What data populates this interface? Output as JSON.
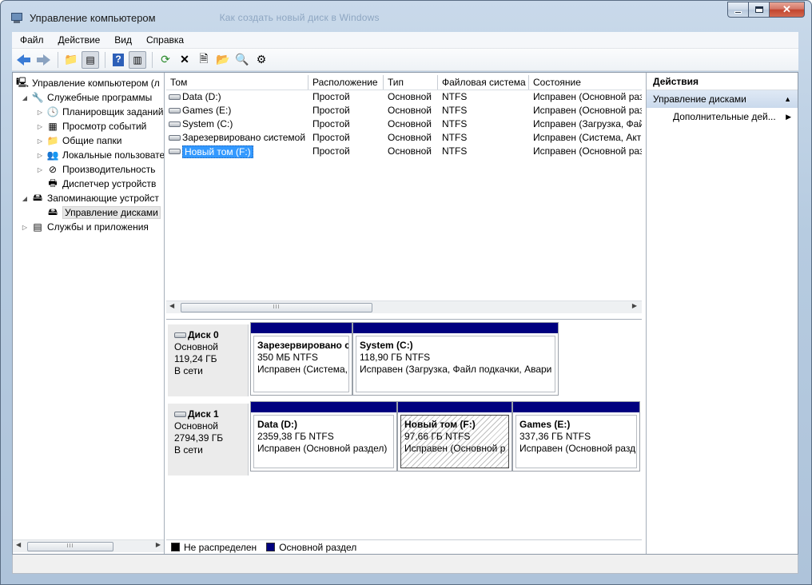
{
  "window": {
    "title": "Управление компьютером",
    "ghost_title": "Как создать новый диск в Windows"
  },
  "menu": [
    "Файл",
    "Действие",
    "Вид",
    "Справка"
  ],
  "tree": {
    "root": "Управление компьютером (л",
    "items": [
      {
        "label": "Служебные программы",
        "icon": "tools-icon"
      },
      {
        "label": "Планировщик заданий",
        "icon": "clock-icon"
      },
      {
        "label": "Просмотр событий",
        "icon": "event-viewer-icon"
      },
      {
        "label": "Общие папки",
        "icon": "shared-folder-icon"
      },
      {
        "label": "Локальные пользовате",
        "icon": "users-icon"
      },
      {
        "label": "Производительность",
        "icon": "performance-icon"
      },
      {
        "label": "Диспетчер устройств",
        "icon": "device-manager-icon"
      },
      {
        "label": "Запоминающие устройст",
        "icon": "storage-icon"
      },
      {
        "label": "Управление дисками",
        "icon": "disk-management-icon"
      },
      {
        "label": "Службы и приложения",
        "icon": "services-icon"
      }
    ]
  },
  "volumes": {
    "headers": [
      "Том",
      "Расположение",
      "Тип",
      "Файловая система",
      "Состояние"
    ],
    "rows": [
      [
        "Data (D:)",
        "Простой",
        "Основной",
        "NTFS",
        "Исправен (Основной раз"
      ],
      [
        "Games (E:)",
        "Простой",
        "Основной",
        "NTFS",
        "Исправен (Основной раз"
      ],
      [
        "System (C:)",
        "Простой",
        "Основной",
        "NTFS",
        "Исправен (Загрузка, Фай"
      ],
      [
        "Зарезервировано системой",
        "Простой",
        "Основной",
        "NTFS",
        "Исправен (Система, Акти"
      ],
      [
        "Новый том (F:)",
        "Простой",
        "Основной",
        "NTFS",
        "Исправен (Основной раз"
      ]
    ]
  },
  "disks": [
    {
      "name": "Диск 0",
      "type": "Основной",
      "size": "119,24 ГБ",
      "status": "В сети",
      "partitions": [
        {
          "name": "Зарезервировано с",
          "size": "350 МБ NTFS",
          "status": "Исправен (Система,"
        },
        {
          "name": "System  (C:)",
          "size": "118,90 ГБ NTFS",
          "status": "Исправен (Загрузка, Файл подкачки, Авари"
        }
      ]
    },
    {
      "name": "Диск 1",
      "type": "Основной",
      "size": "2794,39 ГБ",
      "status": "В сети",
      "partitions": [
        {
          "name": "Data  (D:)",
          "size": "2359,38 ГБ NTFS",
          "status": "Исправен (Основной раздел)"
        },
        {
          "name": "Новый том  (F:)",
          "size": "97,66 ГБ NTFS",
          "status": "Исправен (Основной р"
        },
        {
          "name": "Games  (E:)",
          "size": "337,36 ГБ NTFS",
          "status": "Исправен (Основной разд"
        }
      ]
    }
  ],
  "legend": {
    "unallocated": "Не распределен",
    "primary": "Основной раздел",
    "unallocated_color": "#000000",
    "primary_color": "#00007f"
  },
  "actions": {
    "title": "Действия",
    "group": "Управление дисками",
    "more": "Дополнительные дей..."
  },
  "scroll_glyph": "III"
}
